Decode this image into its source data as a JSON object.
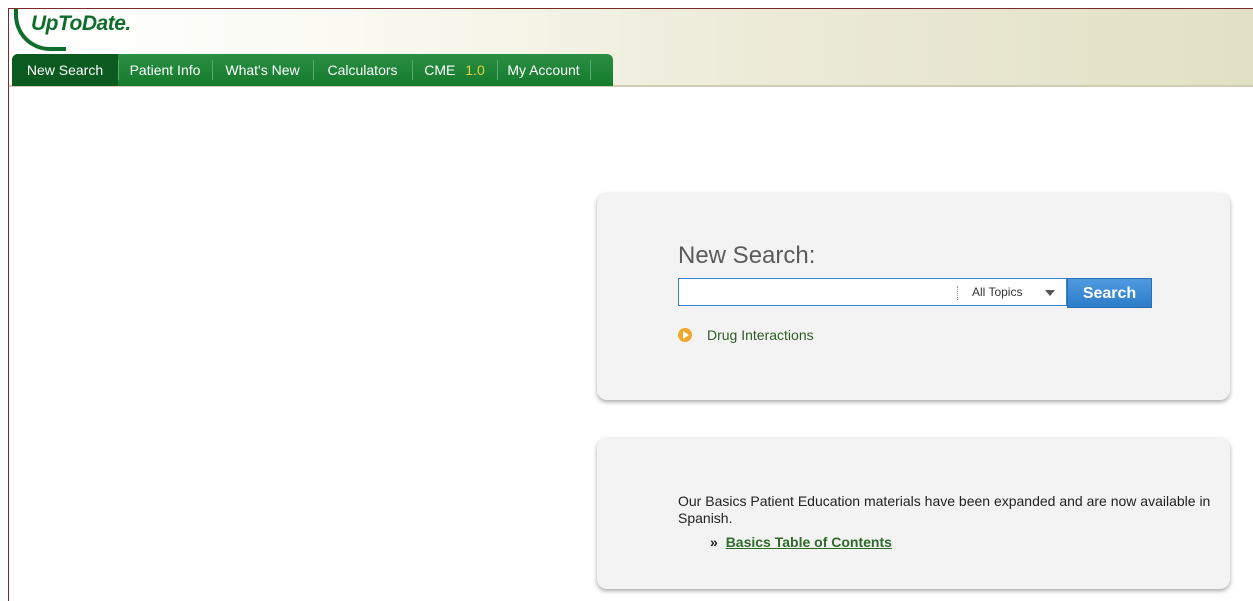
{
  "logo": {
    "text": "UpToDate."
  },
  "nav": {
    "items": [
      {
        "label": "New Search"
      },
      {
        "label": "Patient Info"
      },
      {
        "label": "What's New"
      },
      {
        "label": "Calculators"
      },
      {
        "label": "CME",
        "badge": "1.0"
      },
      {
        "label": "My Account"
      }
    ]
  },
  "search": {
    "title": "New Search:",
    "input_value": "",
    "topic_select": "All Topics",
    "button_label": "Search",
    "drug_link": "Drug Interactions"
  },
  "notice": {
    "text": "Our Basics Patient Education materials have been expanded and are now available in Spanish.",
    "link_prefix": "»",
    "link_text": "Basics Table of Contents"
  },
  "colors": {
    "nav_green": "#147a2c",
    "nav_active": "#0b5a1f",
    "search_blue": "#2c7cc9",
    "accent_orange": "#f2a72a",
    "cme_badge": "#e7d23c"
  }
}
